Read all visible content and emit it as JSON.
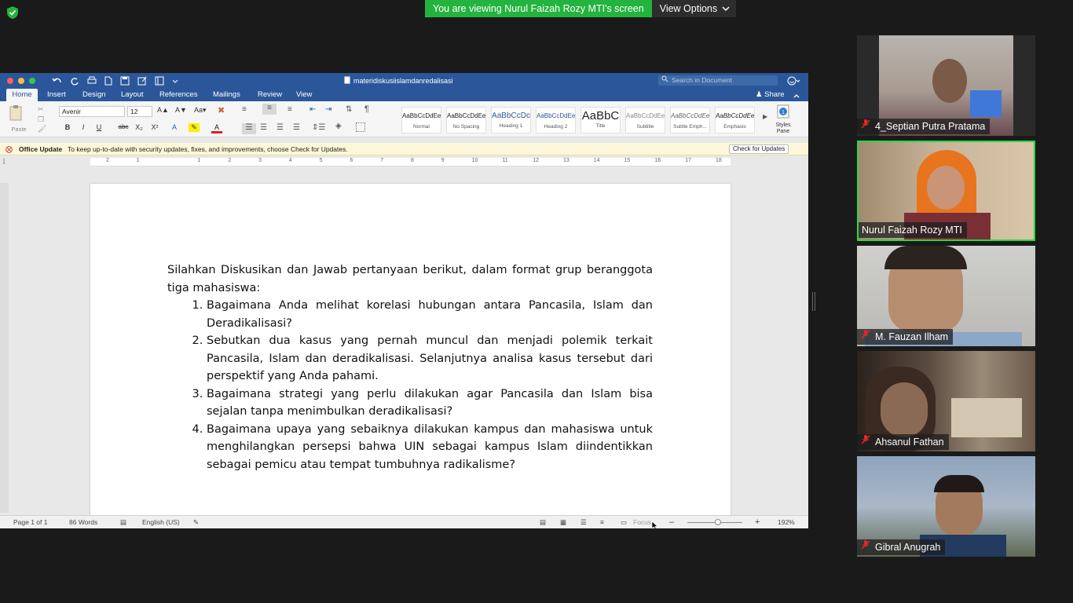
{
  "zoom": {
    "banner": "You are viewing Nurul Faizah Rozy MTI's screen",
    "view_options": "View Options"
  },
  "word": {
    "doc_title": "materidiskusiislamdanredalisasi",
    "search_placeholder": "Search in Document",
    "tabs": [
      "Home",
      "Insert",
      "Design",
      "Layout",
      "References",
      "Mailings",
      "Review",
      "View"
    ],
    "share": "Share",
    "paste_label": "Paste",
    "font": "Avenir",
    "font_size": "12",
    "styles": [
      {
        "preview": "AaBbCcDdEe",
        "label": "Normal"
      },
      {
        "preview": "AaBbCcDdEe",
        "label": "No Spacing"
      },
      {
        "preview": "AaBbCcDc",
        "label": "Heading 1"
      },
      {
        "preview": "AaBbCcDdEe",
        "label": "Heading 2"
      },
      {
        "preview": "AaBbC",
        "label": "Title"
      },
      {
        "preview": "AaBbCcDdEe",
        "label": "Subtitle"
      },
      {
        "preview": "AaBbCcDdEe",
        "label": "Subtle Emph..."
      },
      {
        "preview": "AaBbCcDdEe",
        "label": "Emphasis"
      }
    ],
    "styles_pane": "Styles Pane",
    "office_update_title": "Office Update",
    "office_update_msg": "To keep up-to-date with security updates, fixes, and improvements, choose Check for Updates.",
    "check_updates": "Check for Updates",
    "ruler_numbers": [
      "2",
      "1",
      "",
      "1",
      "2",
      "3",
      "4",
      "5",
      "6",
      "7",
      "8",
      "9",
      "10",
      "11",
      "12",
      "13",
      "14",
      "15",
      "16",
      "17",
      "18"
    ],
    "document": {
      "intro": "Silahkan Diskusikan dan Jawab pertanyaan berikut, dalam format grup beranggota tiga mahasiswa:",
      "items": [
        "Bagaimana Anda melihat korelasi hubungan antara Pancasila, Islam dan Deradikalisasi?",
        "Sebutkan dua kasus yang pernah muncul dan menjadi polemik terkait Pancasila, Islam dan deradikalisasi. Selanjutnya analisa kasus tersebut dari perspektif yang Anda pahami.",
        "Bagaimana strategi yang perlu dilakukan agar Pancasila dan Islam bisa sejalan tanpa menimbulkan deradikalisasi?",
        "Bagaimana upaya yang sebaiknya dilakukan kampus dan mahasiswa untuk menghilangkan persepsi bahwa UIN  sebagai kampus Islam diindentikkan sebagai pemicu atau tempat tumbuhnya radikalisme?"
      ]
    },
    "status": {
      "page": "Page 1 of 1",
      "words": "86 Words",
      "language": "English (US)",
      "focus": "Focus",
      "zoom": "192%",
      "zoom_level": 0.55
    }
  },
  "participants": [
    {
      "name": "4_Septian Putra Pratama",
      "muted": true
    },
    {
      "name": "Nurul Faizah Rozy MTI",
      "muted": false,
      "active": true
    },
    {
      "name": "M. Fauzan Ilham",
      "muted": true
    },
    {
      "name": "Ahsanul Fathan",
      "muted": true
    },
    {
      "name": "Gibral Anugrah",
      "muted": true
    }
  ],
  "colors": {
    "zoom_green": "#23b33f",
    "word_blue": "#2b579a",
    "active_speaker": "#23d94a",
    "mute_red": "#e02828"
  }
}
